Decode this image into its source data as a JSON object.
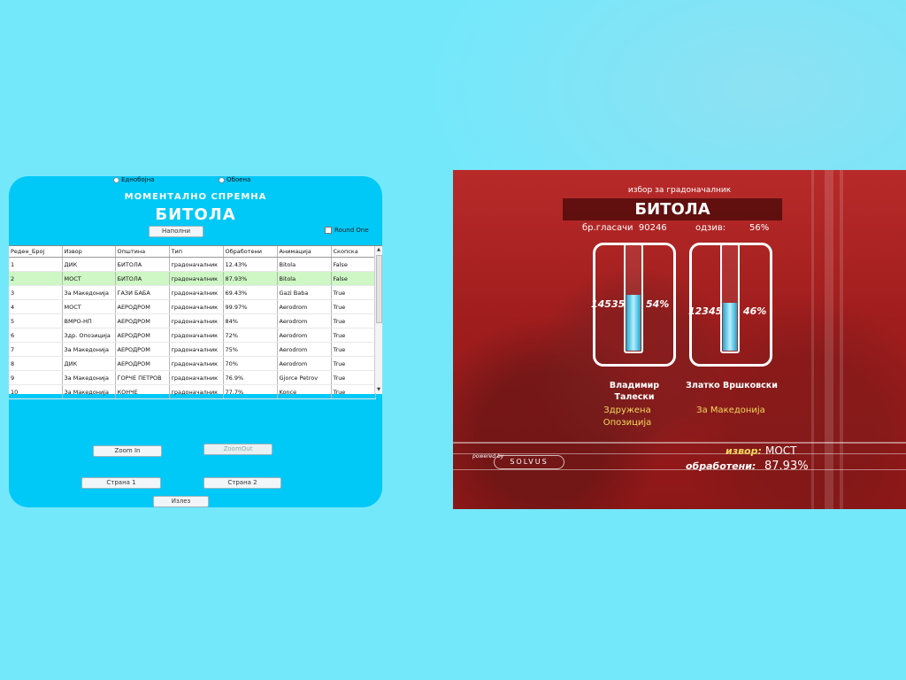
{
  "window": {
    "title": "Моментално спремна"
  },
  "panel": {
    "radio_single": "Еднобојна",
    "radio_color": "Обоена",
    "subtitle": "МОМЕНТАЛНО СПРЕМНА",
    "title": "БИТОЛА",
    "fill_button": "Наполни",
    "round_one_label": "Round One",
    "table": {
      "columns": [
        "Реден_Број",
        "Извор",
        "Општина",
        "Тип",
        "Обработени",
        "Анимација",
        "Скопска"
      ],
      "rows": [
        [
          "1",
          "ДИК",
          "БИТОЛА",
          "градоначалник",
          "12.43%",
          "Bitola",
          "False"
        ],
        [
          "2",
          "МОСТ",
          "БИТОЛА",
          "градоначалник",
          "87.93%",
          "Bitola",
          "False"
        ],
        [
          "3",
          "За Македонија",
          "ГАЗИ БАБА",
          "градоначалник",
          "69.43%",
          "Gazi Baba",
          "True"
        ],
        [
          "4",
          "МОСТ",
          "АЕРОДРОМ",
          "градоначалник",
          "99.97%",
          "Aerodrom",
          "True"
        ],
        [
          "5",
          "ВМРО-НП",
          "АЕРОДРОМ",
          "градоначалник",
          "84%",
          "Aerodrom",
          "True"
        ],
        [
          "6",
          "Здр. Опозиција",
          "АЕРОДРОМ",
          "градоначалник",
          "72%",
          "Aerodrom",
          "True"
        ],
        [
          "7",
          "За Македонија",
          "АЕРОДРОМ",
          "градоначалник",
          "75%",
          "Aerodrom",
          "True"
        ],
        [
          "8",
          "ДИК",
          "АЕРОДРОМ",
          "градоначалник",
          "70%",
          "Aerodrom",
          "True"
        ],
        [
          "9",
          "За Македонија",
          "ЃОРЧЕ ПЕТРОВ",
          "градоначалник",
          "76.9%",
          "Gjorce Petrov",
          "True"
        ],
        [
          "10",
          "За Македонија",
          "КОНЧЕ",
          "градоначалник",
          "77.7%",
          "Konce",
          "True"
        ]
      ],
      "selected_row": 1
    },
    "zoom_in_button": "Zoom In",
    "zoom_out_button": "ZoomOut",
    "page1_button": "Страна 1",
    "page2_button": "Страна 2",
    "exit_button": "Излез"
  },
  "broadcast": {
    "subtitle": "избор за градоначалник",
    "title": "БИТОЛА",
    "voters_label": "бр.гласачи",
    "voters_value": "90246",
    "turnout_label": "одзив:",
    "turnout_value": "56%",
    "candidates": [
      {
        "votes": "14535",
        "percent_label": "54%",
        "percent": 54,
        "name": [
          "Владимир",
          "Талески"
        ],
        "party": [
          "Здружена",
          "Опозиција"
        ]
      },
      {
        "votes": "12345",
        "percent_label": "46%",
        "percent": 46,
        "name": [
          "Златко Вршковски"
        ],
        "party": [
          "За Македонија"
        ]
      }
    ],
    "powered_by": "powered by",
    "logo_text": "SOLVUS",
    "source_label": "извор:",
    "source_value": "МОСТ",
    "processed_label": "обработени:",
    "processed_value": "87.93%"
  },
  "colors": {
    "page_bg": "#74e8fb",
    "panel_bg": "#00c8f7",
    "selected_row": "#cef7c5",
    "broadcast_bg": "#a01d1d",
    "party_text": "#f2d95a"
  }
}
